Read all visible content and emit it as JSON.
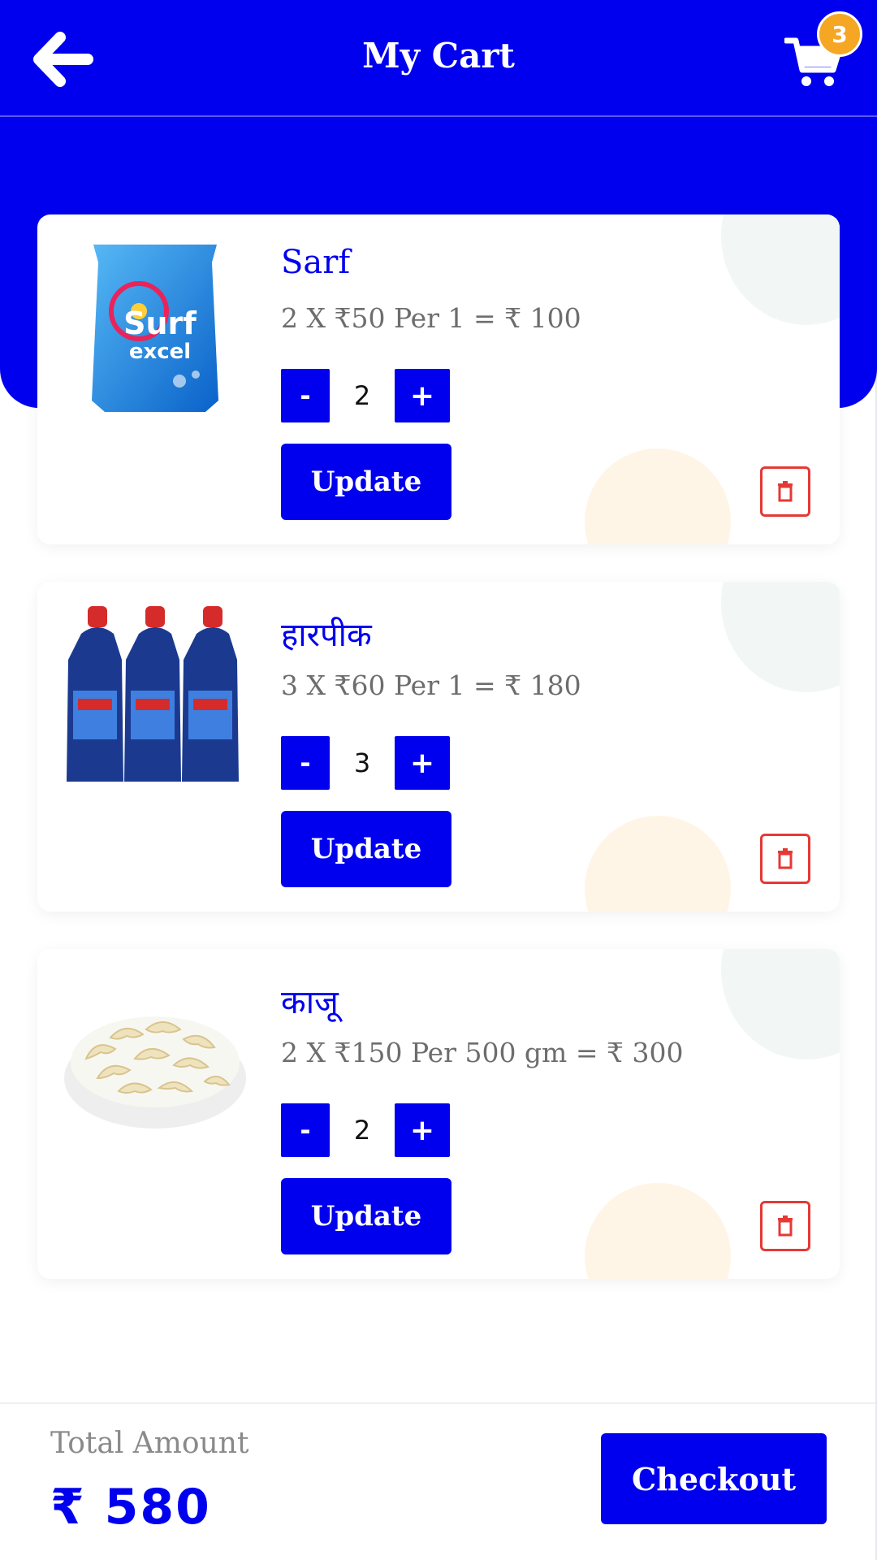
{
  "header": {
    "title": "My Cart",
    "cart_count": "3",
    "colors": {
      "primary": "#0000ee",
      "badge": "#f5a623"
    }
  },
  "cart": {
    "items": [
      {
        "name": "Sarf",
        "price_line": "2 X ₹50 Per 1 = ₹ 100",
        "qty": "2",
        "update_label": "Update",
        "image": "surf-excel-pack"
      },
      {
        "name": "हारपीक",
        "price_line": "3 X ₹60 Per 1 = ₹ 180",
        "qty": "3",
        "update_label": "Update",
        "image": "harpic-bottles"
      },
      {
        "name": "काजू",
        "price_line": "2 X ₹150 Per 500 gm = ₹ 300",
        "qty": "2",
        "update_label": "Update",
        "image": "cashew-bowl"
      }
    ],
    "minus_label": "-",
    "plus_label": "+"
  },
  "footer": {
    "total_label": "Total Amount",
    "total_value": "₹ 580",
    "checkout_label": "Checkout"
  }
}
